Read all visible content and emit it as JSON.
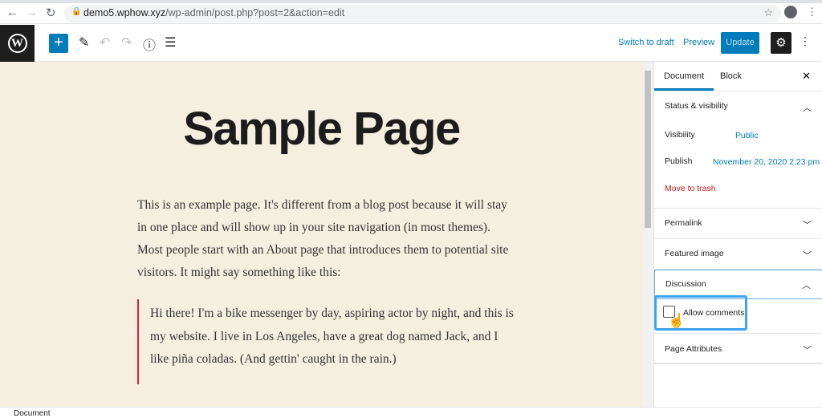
{
  "browser": {
    "url_host": "demo5.wphow.xyz",
    "url_path": "/wp-admin/post.php?post=2&action=edit"
  },
  "toolbar": {
    "switch_to_draft": "Switch to draft",
    "preview": "Preview",
    "update": "Update"
  },
  "post": {
    "title": "Sample Page",
    "paragraph": "This is an example page. It's different from a blog post because it will stay in one place and will show up in your site navigation (in most themes). Most people start with an About page that introduces them to potential site visitors. It might say something like this:",
    "quote": "Hi there! I'm a bike messenger by day, aspiring actor by night, and this is my website. I live in Los Angeles, have a great dog named Jack, and I like piña coladas. (And gettin' caught in the rain.)"
  },
  "sidebar": {
    "tabs": [
      "Document",
      "Block"
    ],
    "status": {
      "title": "Status & visibility",
      "visibility_label": "Visibility",
      "visibility_value": "Public",
      "publish_label": "Publish",
      "publish_value": "November 20, 2020 2:23 pm",
      "trash": "Move to trash"
    },
    "permalink": "Permalink",
    "featured_image": "Featured image",
    "discussion": {
      "title": "Discussion",
      "allow_comments": "Allow comments",
      "checked": false
    },
    "page_attributes": "Page Attributes"
  },
  "footer": {
    "breadcrumb": "Document"
  },
  "colors": {
    "accent": "#007cba",
    "highlight": "#3ea2f2",
    "trash": "#cc1818",
    "content_bg": "#f5efe0",
    "quote_border": "#cd2653"
  }
}
